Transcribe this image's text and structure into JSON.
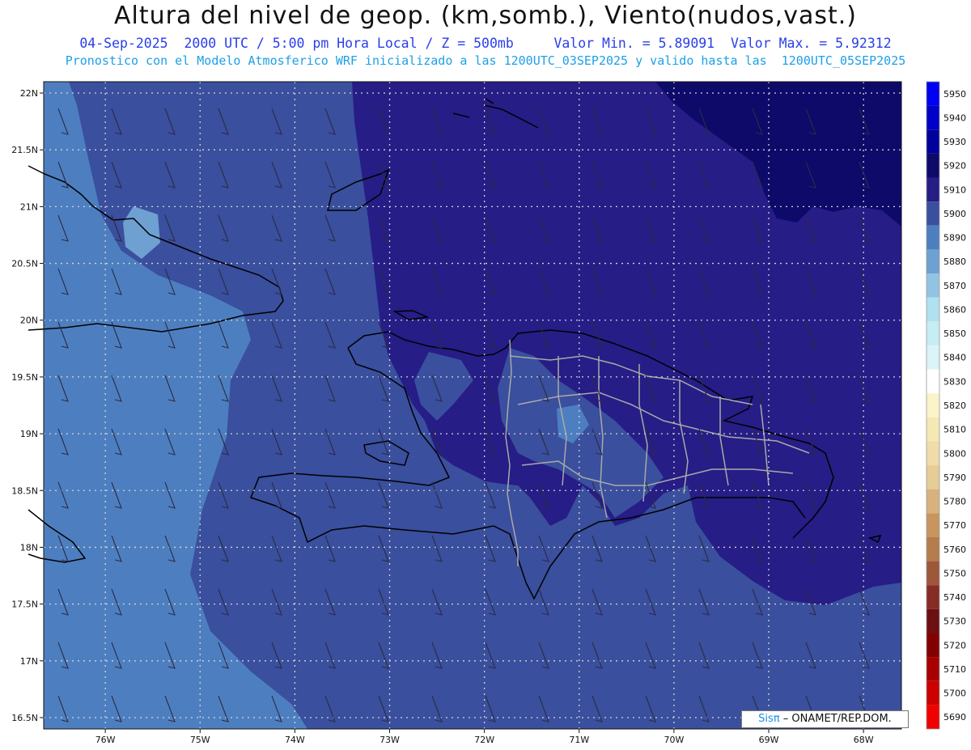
{
  "header": {
    "title": "Altura del nivel de geop. (km,somb.), Viento(nudos,vast.)",
    "subtitle_datetime": "04-Sep-2025  2000 UTC / 5:00 pm Hora Local / Z = 500mb",
    "subtitle_minmax": "Valor Min. = 5.89091  Valor Max. = 5.92312",
    "subtitle_model": "Pronostico con el Modelo Atmosferico WRF inicializado a las 1200UTC_03SEP2025 y valido hasta las  1200UTC_05SEP2025"
  },
  "axes": {
    "lat_labels": [
      "22N",
      "21.5N",
      "21N",
      "20.5N",
      "20N",
      "19.5N",
      "19N",
      "18.5N",
      "18N",
      "17.5N",
      "17N",
      "16.5N"
    ],
    "lon_labels": [
      "76W",
      "75W",
      "74W",
      "73W",
      "72W",
      "71W",
      "70W",
      "69W",
      "68W"
    ],
    "lat_range": [
      16.4,
      22.1
    ],
    "lon_range": [
      -76.65,
      -67.6
    ]
  },
  "colorbar": {
    "levels": [
      {
        "label": "5950",
        "color": "#0000f2"
      },
      {
        "label": "5940",
        "color": "#0000c8"
      },
      {
        "label": "5930",
        "color": "#00009a"
      },
      {
        "label": "5920",
        "color": "#0d0a6a"
      },
      {
        "label": "5910",
        "color": "#261d86"
      },
      {
        "label": "5900",
        "color": "#3a4f9d"
      },
      {
        "label": "5890",
        "color": "#4d7fc0"
      },
      {
        "label": "5880",
        "color": "#6ea0d2"
      },
      {
        "label": "5870",
        "color": "#93c3e3"
      },
      {
        "label": "5860",
        "color": "#b0e1ef"
      },
      {
        "label": "5850",
        "color": "#c6ecf4"
      },
      {
        "label": "5840",
        "color": "#daf4f8"
      },
      {
        "label": "5830",
        "color": "#ffffff"
      },
      {
        "label": "5820",
        "color": "#fbf3c9"
      },
      {
        "label": "5810",
        "color": "#f5e8b5"
      },
      {
        "label": "5800",
        "color": "#efdcaa"
      },
      {
        "label": "5790",
        "color": "#e6cc96"
      },
      {
        "label": "5780",
        "color": "#d8b27e"
      },
      {
        "label": "5770",
        "color": "#c8955f"
      },
      {
        "label": "5760",
        "color": "#b57c4d"
      },
      {
        "label": "5750",
        "color": "#9e573a"
      },
      {
        "label": "5740",
        "color": "#872b25"
      },
      {
        "label": "5730",
        "color": "#6e0f14"
      },
      {
        "label": "5720",
        "color": "#820000"
      },
      {
        "label": "5710",
        "color": "#a80000"
      },
      {
        "label": "5700",
        "color": "#cc0000"
      },
      {
        "label": "5690",
        "color": "#f00000"
      }
    ]
  },
  "credit": {
    "sis": "Sis",
    "pi": "π",
    "rest": "– ONAMET/REP.DOM."
  },
  "icons": {
    "wind": "wind-barb-icon"
  }
}
